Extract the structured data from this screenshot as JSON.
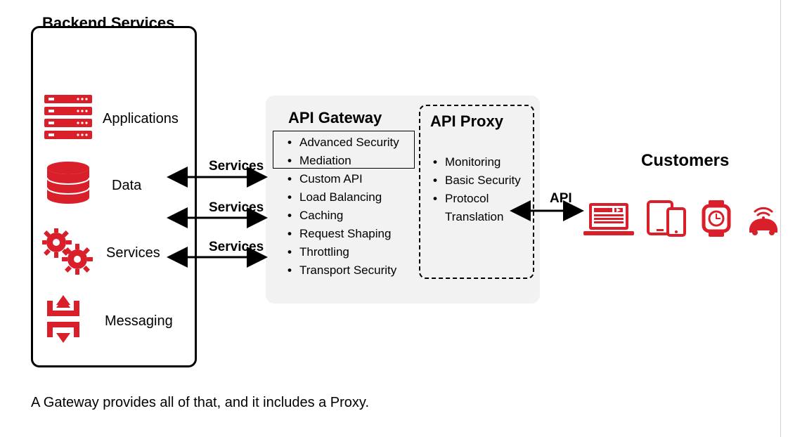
{
  "backend": {
    "title": "Backend Services",
    "items": {
      "applications": "Applications",
      "data": "Data",
      "services": "Services",
      "messaging": "Messaging"
    }
  },
  "connectors": {
    "services1": "Services",
    "services2": "Services",
    "services3": "Services",
    "api": "API"
  },
  "gateway": {
    "title": "API Gateway",
    "items": [
      "Advanced Security",
      "Mediation",
      "Custom API",
      "Load Balancing",
      "Caching",
      "Request Shaping",
      "Throttling",
      "Transport Security"
    ]
  },
  "proxy": {
    "title": "API Proxy",
    "items": [
      "Monitoring",
      "Basic Security",
      "Protocol Translation"
    ]
  },
  "customers": {
    "title": "Customers"
  },
  "caption": "A Gateway provides all of that, and it includes a Proxy.",
  "colors": {
    "accent": "#d91f2a"
  }
}
